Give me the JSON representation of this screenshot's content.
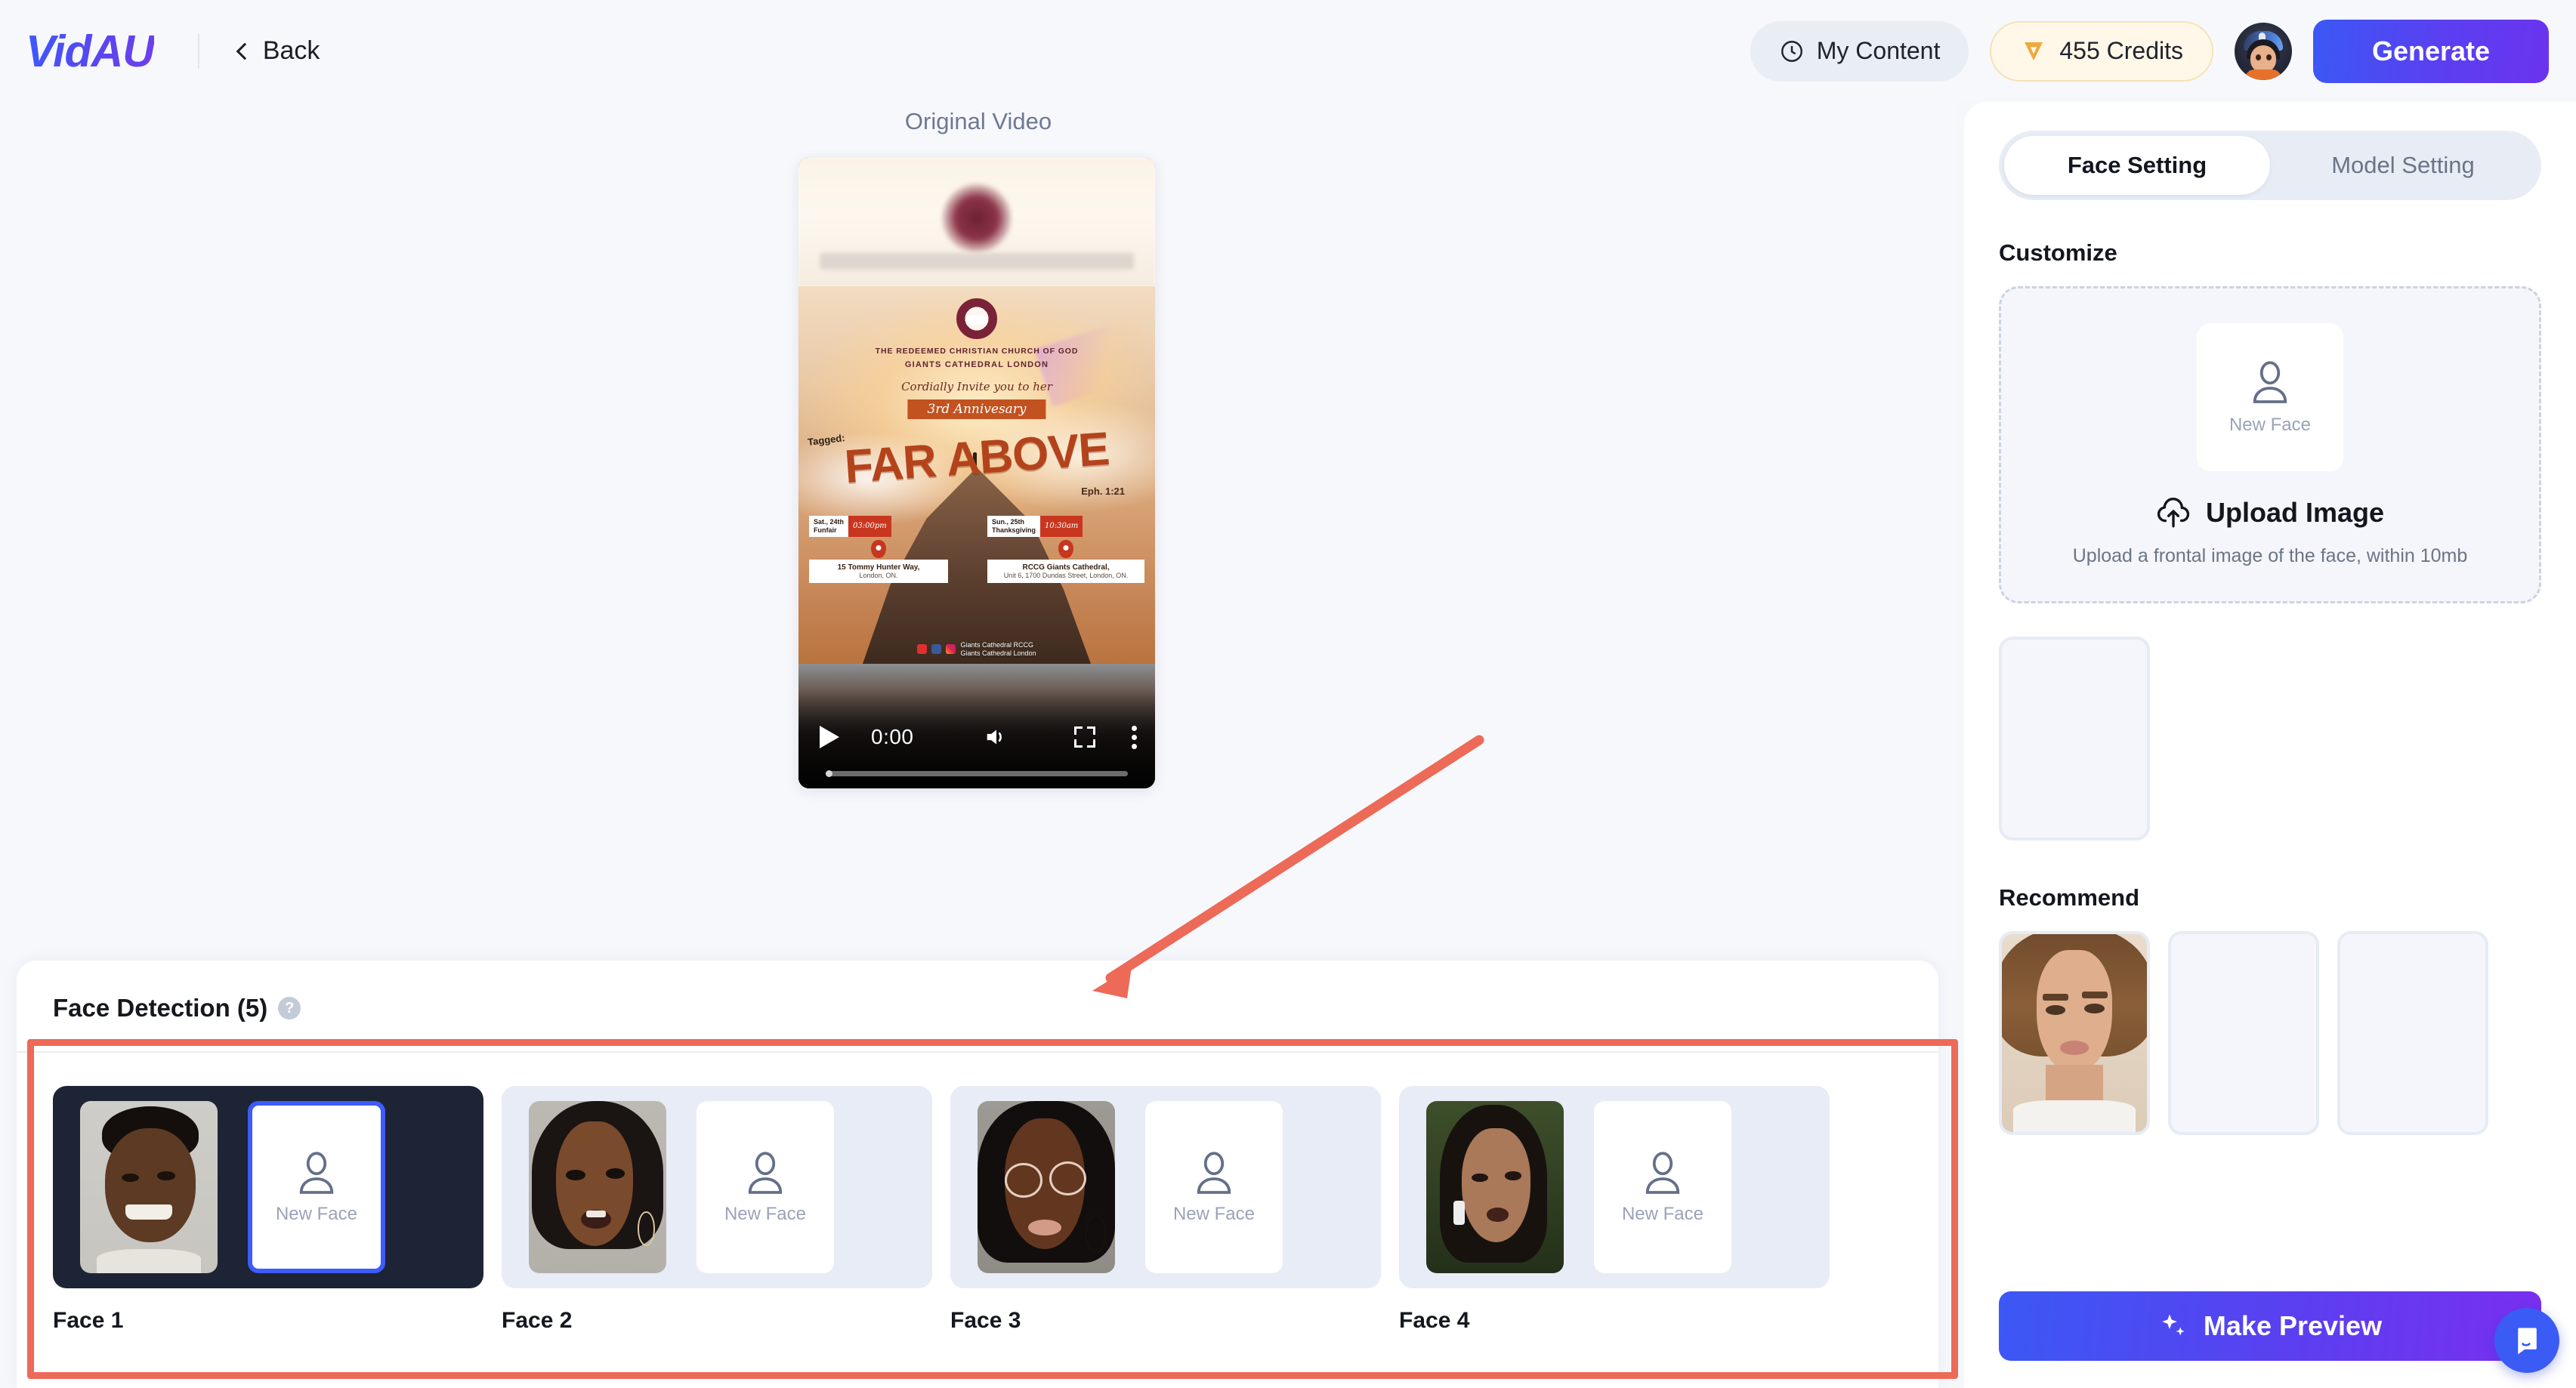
{
  "header": {
    "logo": "VidAU",
    "back_label": "Back",
    "my_content_label": "My Content",
    "credits_label": "455 Credits",
    "generate_label": "Generate",
    "accent_color": "#3b58f5",
    "credits_color": "#f0a73c"
  },
  "stage": {
    "video_label": "Original Video",
    "player": {
      "play_icon": "play-icon",
      "current_time": "0:00",
      "volume_icon": "volume-icon",
      "fullscreen_icon": "fullscreen-icon",
      "more_icon": "more-options-icon"
    },
    "poster": {
      "org_line1": "THE REDEEMED CHRISTIAN CHURCH OF GOD",
      "org_line2": "GIANTS CATHEDRAL LONDON",
      "invite_script": "Cordially Invite you to her",
      "anniversary": "3rd Annivesary",
      "tagged": "Tagged:",
      "title": "FAR ABOVE",
      "verse": "Eph. 1:21",
      "event_left_date": "Sat., 24th",
      "event_left_name": "Funfair",
      "event_left_time": "03:00pm",
      "event_left_addr1": "15 Tommy Hunter Way,",
      "event_left_addr2": "London, ON.",
      "event_right_date": "Sun., 25th",
      "event_right_name": "Thanksgiving",
      "event_right_time": "10:30am",
      "event_right_addr1": "RCCG Giants Cathedral,",
      "event_right_addr2": "Unit 6, 1700 Dundas Street, London, ON.",
      "social_line1": "Giants Cathedral RCCG",
      "social_line2": "Giants Cathedral London"
    }
  },
  "face_detection": {
    "title": "Face Detection (5)",
    "help_icon": "help-circle-icon",
    "new_face_label": "New Face",
    "cards": [
      {
        "name": "Face 1",
        "selected": true,
        "slot_active": true
      },
      {
        "name": "Face 2",
        "selected": false,
        "slot_active": false
      },
      {
        "name": "Face 3",
        "selected": false,
        "slot_active": false
      },
      {
        "name": "Face 4",
        "selected": false,
        "slot_active": false
      }
    ]
  },
  "right_panel": {
    "tabs": [
      {
        "label": "Face Setting",
        "active": true
      },
      {
        "label": "Model Setting",
        "active": false
      }
    ],
    "customize_title": "Customize",
    "upload": {
      "new_face_label": "New Face",
      "upload_label": "Upload Image",
      "hint": "Upload a frontal image of the face, within 10mb",
      "icon": "cloud-upload-icon"
    },
    "recommend_title": "Recommend",
    "recommend_cards": [
      {
        "has_image": true
      },
      {
        "has_image": false
      },
      {
        "has_image": false
      }
    ],
    "preview_button": {
      "label": "Make Preview",
      "icon": "sparkles-icon"
    },
    "chat_icon": "chat-bubble-icon"
  },
  "annotations": {
    "rect_color": "#ec6a57",
    "arrow_color": "#ec6a57"
  }
}
